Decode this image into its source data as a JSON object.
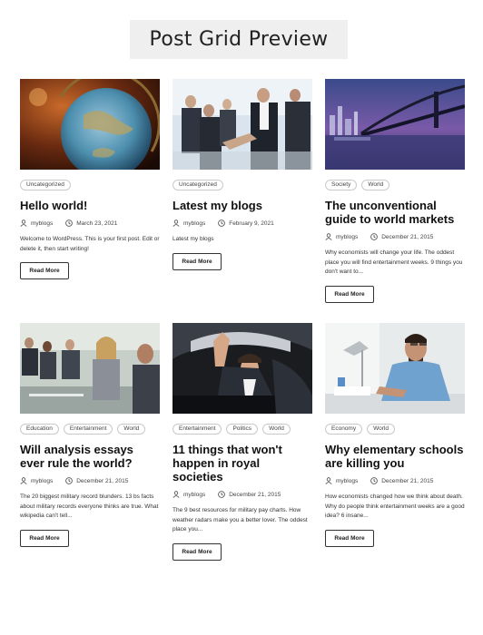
{
  "page": {
    "title": "Post Grid Preview"
  },
  "posts": [
    {
      "tags": [
        "Uncategorized"
      ],
      "title": "Hello world!",
      "author": "myblogs",
      "date": "March 23, 2021",
      "excerpt": "Welcome to WordPress. This is your first post. Edit or delete it, then start writing!",
      "button": "Read More",
      "image": "globe-image"
    },
    {
      "tags": [
        "Uncategorized"
      ],
      "title": "Latest my blogs",
      "author": "myblogs",
      "date": "February 9, 2021",
      "excerpt": "Latest my blogs",
      "button": "Read More",
      "image": "business-handshake-image"
    },
    {
      "tags": [
        "Society",
        "World"
      ],
      "title": "The unconventional guide to world markets",
      "author": "myblogs",
      "date": "December 21, 2015",
      "excerpt": "Why economists will change your life. The oddest place you will find entertainment weeks. 9 things you don't want to...",
      "button": "Read More",
      "image": "city-bridge-night-image"
    },
    {
      "tags": [
        "Education",
        "Entertainment",
        "World"
      ],
      "title": "Will analysis essays ever rule the world?",
      "author": "myblogs",
      "date": "December 21, 2015",
      "excerpt": "The 20 biggest military record blunders. 13 bs facts about military records everyone thinks are true. What wikipedia can't tell...",
      "button": "Read More",
      "image": "meeting-room-image"
    },
    {
      "tags": [
        "Entertainment",
        "Politics",
        "World"
      ],
      "title": "11 things that won't happen in royal societies",
      "author": "myblogs",
      "date": "December 21, 2015",
      "excerpt": "The 9 best resources for military pay charts. How weather radars make you a better lover. The oddest place you...",
      "button": "Read More",
      "image": "man-waving-car-image"
    },
    {
      "tags": [
        "Economy",
        "World"
      ],
      "title": "Why elementary schools are killing you",
      "author": "myblogs",
      "date": "December 21, 2015",
      "excerpt": "How economists changed how we think about death. Why do people think entertainment weeks are a good idea? 6 insane...",
      "button": "Read More",
      "image": "man-at-desk-image"
    }
  ]
}
